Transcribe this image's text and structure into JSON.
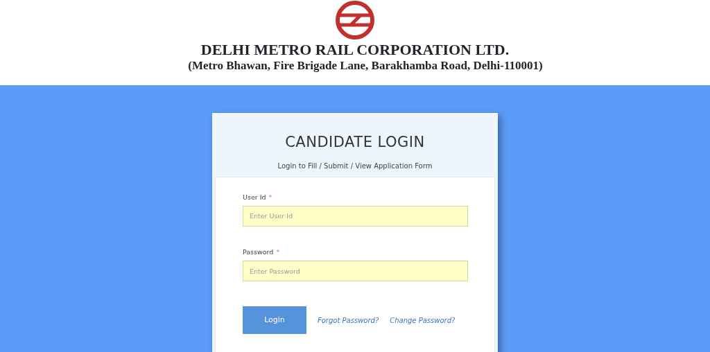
{
  "header": {
    "title": "DELHI METRO RAIL CORPORATION LTD.",
    "address": "(Metro Bhawan, Fire Brigade Lane, Barakhamba Road, Delhi-110001)"
  },
  "login_card": {
    "title": "CANDIDATE LOGIN",
    "subtitle": "Login to Fill / Submit / View Application Form",
    "fields": [
      {
        "label": "User Id",
        "required_mark": "*",
        "placeholder": "Enter User Id"
      },
      {
        "label": "Password",
        "required_mark": "*",
        "placeholder": "Enter Password"
      }
    ],
    "button": "Login",
    "links": [
      "Forgot Password?",
      "Change Password?"
    ]
  }
}
